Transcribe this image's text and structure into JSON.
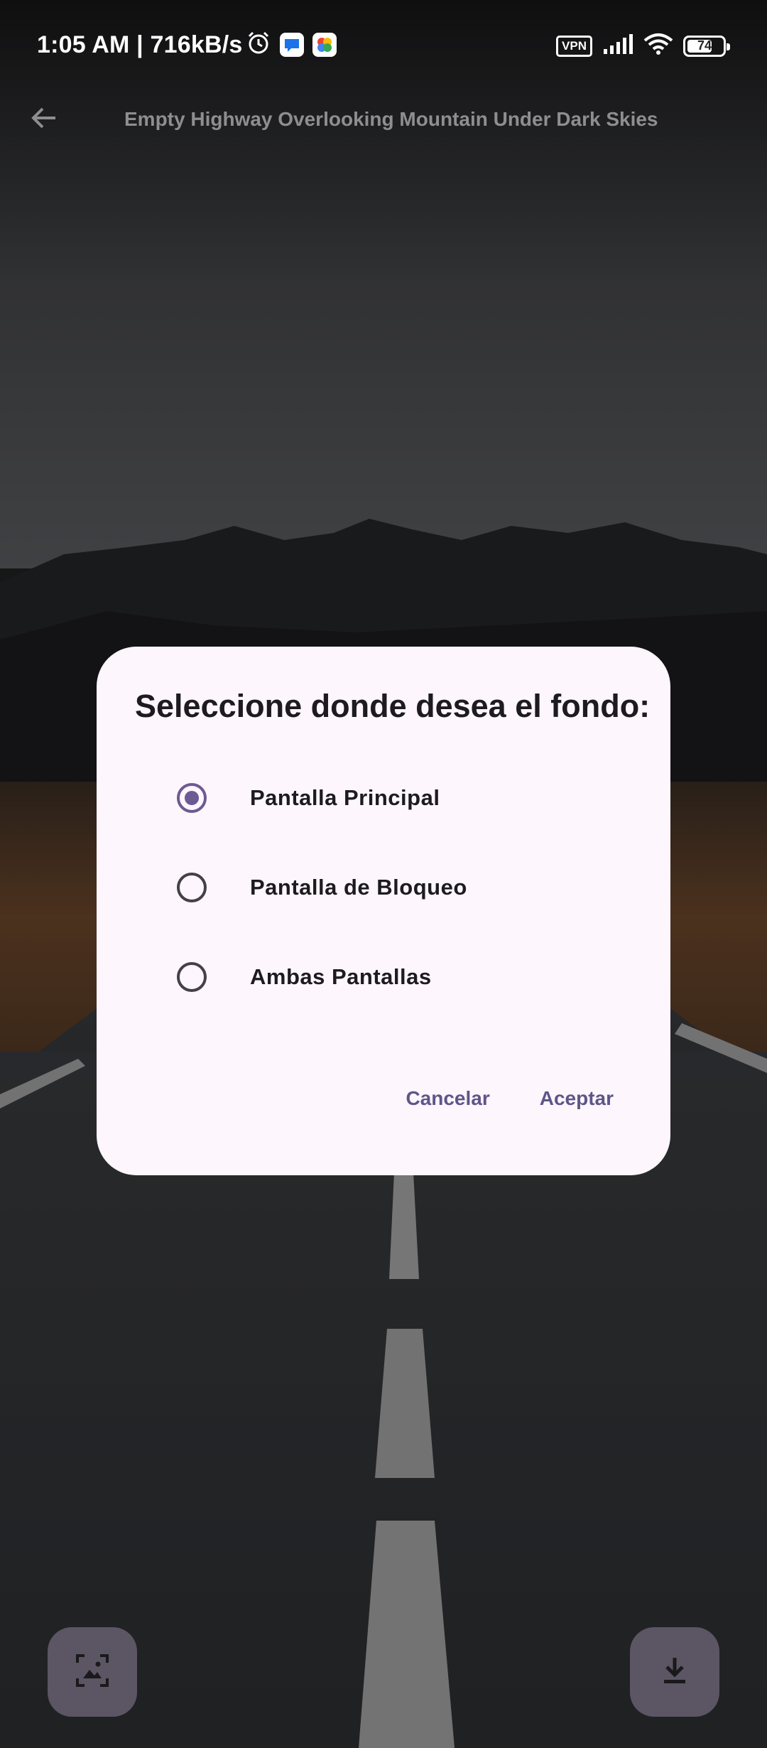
{
  "status_bar": {
    "time": "1:05 AM | 716kB/s",
    "vpn": "VPN",
    "battery": "74",
    "battery_level": 0.74,
    "icons": [
      "alarm-icon",
      "messages-app-icon",
      "photos-app-icon",
      "signal-icon",
      "wifi-icon",
      "battery-icon"
    ]
  },
  "app_bar": {
    "title": "Empty Highway Overlooking Mountain Under Dark Skies",
    "back_icon": "arrow-back-icon"
  },
  "dialog": {
    "title": "Seleccione donde desea el fondo:",
    "options": [
      {
        "label": "Pantalla Principal",
        "selected": true
      },
      {
        "label": "Pantalla de Bloqueo",
        "selected": false
      },
      {
        "label": "Ambas Pantallas",
        "selected": false
      }
    ],
    "cancel_label": "Cancelar",
    "accept_label": "Aceptar"
  },
  "fabs": {
    "left_icon": "set-wallpaper-icon",
    "right_icon": "download-icon"
  },
  "colors": {
    "accent": "#6c5a92",
    "dialog_bg": "#fdf6fd",
    "fab_bg": "#5c5563",
    "button_text": "#5e5688"
  }
}
